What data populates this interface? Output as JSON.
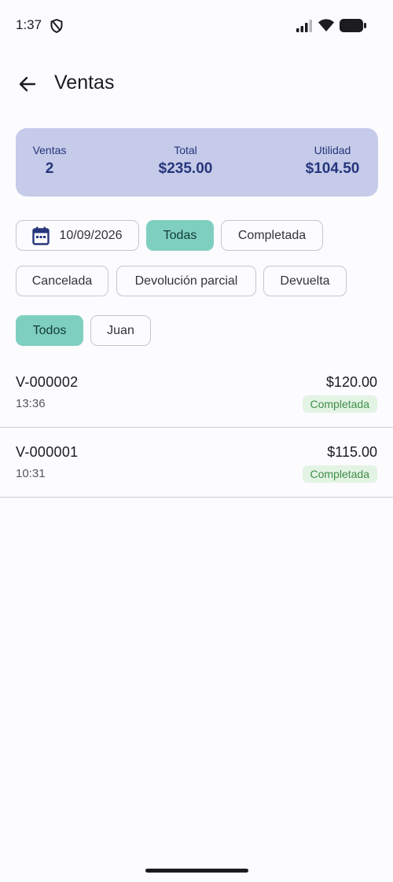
{
  "status_bar": {
    "time": "1:37",
    "icons": [
      "shield-icon",
      "signal-icon",
      "wifi-icon",
      "battery-icon"
    ]
  },
  "app_bar": {
    "back_icon": "arrow-left-icon",
    "title": "Ventas"
  },
  "summary": {
    "ventas_label": "Ventas",
    "ventas_value": "2",
    "total_label": "Total",
    "total_value": "$235.00",
    "utilidad_label": "Utilidad",
    "utilidad_value": "$104.50"
  },
  "filters": {
    "date": {
      "icon": "calendar-icon",
      "value": "10/09/2026"
    },
    "status_chips": [
      {
        "label": "Todas",
        "selected": true
      },
      {
        "label": "Completada",
        "selected": false
      },
      {
        "label": "Cancelada",
        "selected": false
      },
      {
        "label": "Devolución parcial",
        "selected": false
      },
      {
        "label": "Devuelta",
        "selected": false
      }
    ],
    "user_chips": [
      {
        "label": "Todos",
        "selected": true
      },
      {
        "label": "Juan",
        "selected": false
      }
    ]
  },
  "sales": [
    {
      "id": "V-000002",
      "time": "13:36",
      "amount": "$120.00",
      "status": "Completada"
    },
    {
      "id": "V-000001",
      "time": "10:31",
      "amount": "$115.00",
      "status": "Completada"
    }
  ],
  "colors": {
    "background": "#fcfbfe",
    "summary_card": "#c5cbe9",
    "summary_text": "#26357c",
    "chip_selected": "#7fcfc0",
    "status_badge_bg": "#e3f3e4",
    "status_badge_text": "#3f8f48"
  }
}
